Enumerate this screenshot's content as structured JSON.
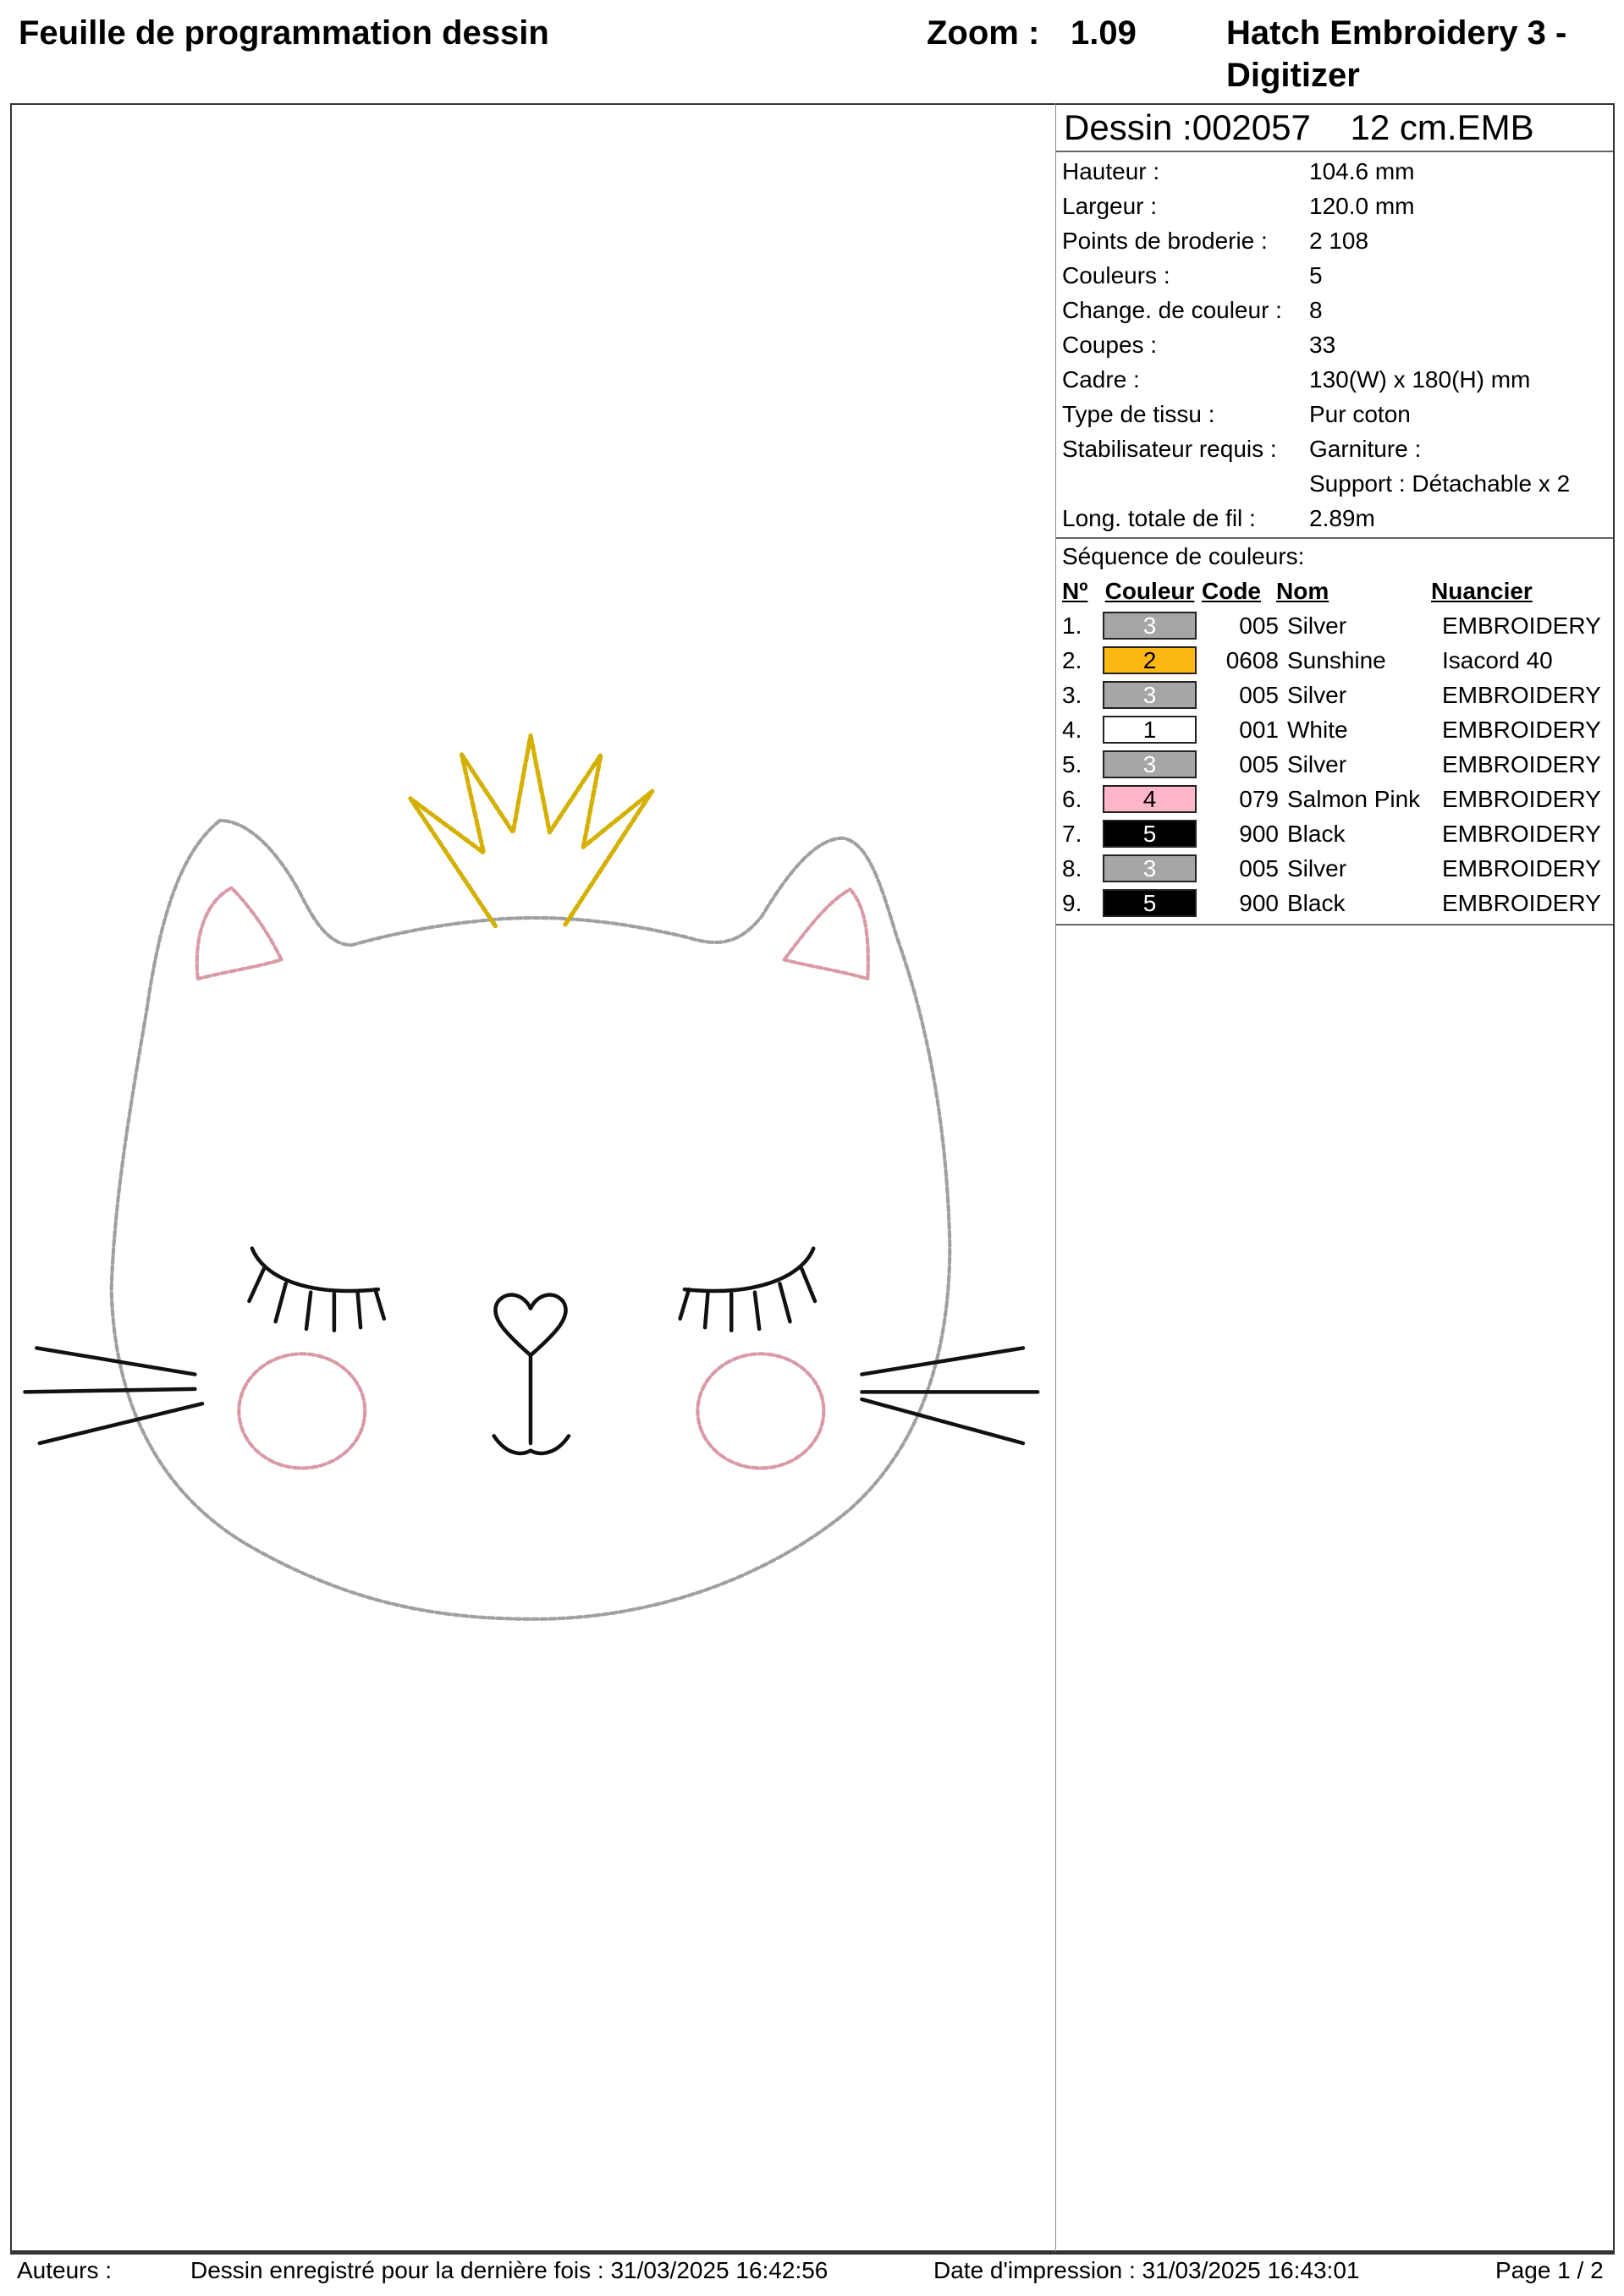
{
  "header": {
    "title": "Feuille de programmation dessin",
    "zoom_label": "Zoom :",
    "zoom_value": "1.09",
    "app": "Hatch Embroidery 3 - Digitizer"
  },
  "design": {
    "title": "Dessin :002057    12 cm.EMB",
    "info": [
      {
        "label": "Hauteur :",
        "value": "104.6 mm"
      },
      {
        "label": "Largeur :",
        "value": "120.0 mm"
      },
      {
        "label": "Points de broderie :",
        "value": "2 108"
      },
      {
        "label": "Couleurs :",
        "value": "5"
      },
      {
        "label": "Change. de couleur :",
        "value": "8"
      },
      {
        "label": "Coupes :",
        "value": "33"
      },
      {
        "label": "Cadre :",
        "value": "130(W) x 180(H) mm"
      },
      {
        "label": "Type de tissu :",
        "value": "Pur coton"
      },
      {
        "label": "Stabilisateur requis :",
        "value": "Garniture :",
        "value2": "Support : Détachable x 2"
      },
      {
        "label": "Long. totale de fil :",
        "value": "2.89m"
      }
    ]
  },
  "sequence": {
    "title": "Séquence de couleurs:",
    "headers": {
      "no": "Nº",
      "color": "Couleur",
      "code": "Code",
      "name": "Nom",
      "chart": "Nuancier"
    },
    "rows": [
      {
        "no": "1.",
        "num": "3",
        "hex": "#a6a6a6",
        "text": "#ffffff",
        "code": "005",
        "name": "Silver",
        "chart": "EMBROIDERY"
      },
      {
        "no": "2.",
        "num": "2",
        "hex": "#fdb913",
        "text": "#000000",
        "code": "0608",
        "name": "Sunshine",
        "chart": "Isacord 40"
      },
      {
        "no": "3.",
        "num": "3",
        "hex": "#a6a6a6",
        "text": "#ffffff",
        "code": "005",
        "name": "Silver",
        "chart": "EMBROIDERY"
      },
      {
        "no": "4.",
        "num": "1",
        "hex": "#ffffff",
        "text": "#000000",
        "code": "001",
        "name": "White",
        "chart": "EMBROIDERY"
      },
      {
        "no": "5.",
        "num": "3",
        "hex": "#a6a6a6",
        "text": "#ffffff",
        "code": "005",
        "name": "Silver",
        "chart": "EMBROIDERY"
      },
      {
        "no": "6.",
        "num": "4",
        "hex": "#ffb6c8",
        "text": "#000000",
        "code": "079",
        "name": "Salmon Pink",
        "chart": "EMBROIDERY"
      },
      {
        "no": "7.",
        "num": "5",
        "hex": "#000000",
        "text": "#ffffff",
        "code": "900",
        "name": "Black",
        "chart": "EMBROIDERY"
      },
      {
        "no": "8.",
        "num": "3",
        "hex": "#a6a6a6",
        "text": "#ffffff",
        "code": "005",
        "name": "Silver",
        "chart": "EMBROIDERY"
      },
      {
        "no": "9.",
        "num": "5",
        "hex": "#000000",
        "text": "#ffffff",
        "code": "900",
        "name": "Black",
        "chart": "EMBROIDERY"
      }
    ]
  },
  "footer": {
    "authors": "Auteurs :",
    "saved": "Dessin enregistré pour la dernière fois : 31/03/2025 16:42:56",
    "printed": "Date d'impression : 31/03/2025 16:43:01",
    "page": "Page 1 / 2"
  },
  "colors": {
    "silver": "#a6a6a6",
    "sunshine": "#e6c21a",
    "pink": "#d99aa8",
    "black": "#111111"
  }
}
